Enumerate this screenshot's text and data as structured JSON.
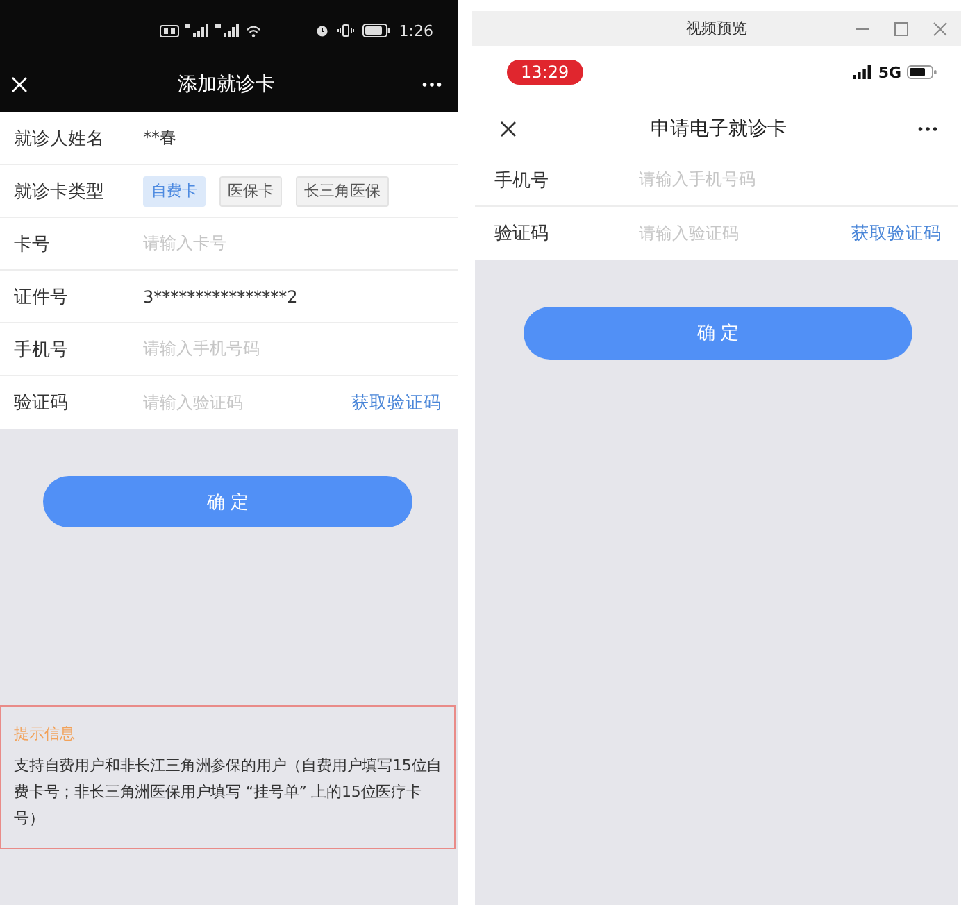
{
  "left_phone": {
    "status_bar": {
      "time": "1:26"
    },
    "nav": {
      "title": "添加就诊卡"
    },
    "form": [
      {
        "kind": "value",
        "label": "就诊人姓名",
        "value": "**春"
      },
      {
        "kind": "options",
        "label": "就诊卡类型",
        "options": [
          {
            "label": "自费卡",
            "selected": true
          },
          {
            "label": "医保卡",
            "selected": false
          },
          {
            "label": "长三角医保",
            "selected": false
          }
        ]
      },
      {
        "kind": "input",
        "label": "卡号",
        "placeholder": "请输入卡号"
      },
      {
        "kind": "value",
        "label": "证件号",
        "value": "3****************2"
      },
      {
        "kind": "input",
        "label": "手机号",
        "placeholder": "请输入手机号码"
      },
      {
        "kind": "code",
        "label": "验证码",
        "placeholder": "请输入验证码",
        "action": "获取验证码"
      }
    ],
    "confirm_button": "确 定",
    "hint": {
      "title": "提示信息",
      "text": "支持自费用户和非长江三角洲参保的用户（自费用户填写15位自费卡号；非长三角洲医保用户填写 “挂号单” 上的15位医疗卡号）"
    }
  },
  "right_window": {
    "title": "视频预览",
    "status_bar": {
      "time": "13:29",
      "network": "5G"
    },
    "nav": {
      "title": "申请电子就诊卡"
    },
    "form": [
      {
        "kind": "input",
        "label": "手机号",
        "placeholder": "请输入手机号码"
      },
      {
        "kind": "code",
        "label": "验证码",
        "placeholder": "请输入验证码",
        "action": "获取验证码"
      }
    ],
    "confirm_button": "确 定"
  }
}
